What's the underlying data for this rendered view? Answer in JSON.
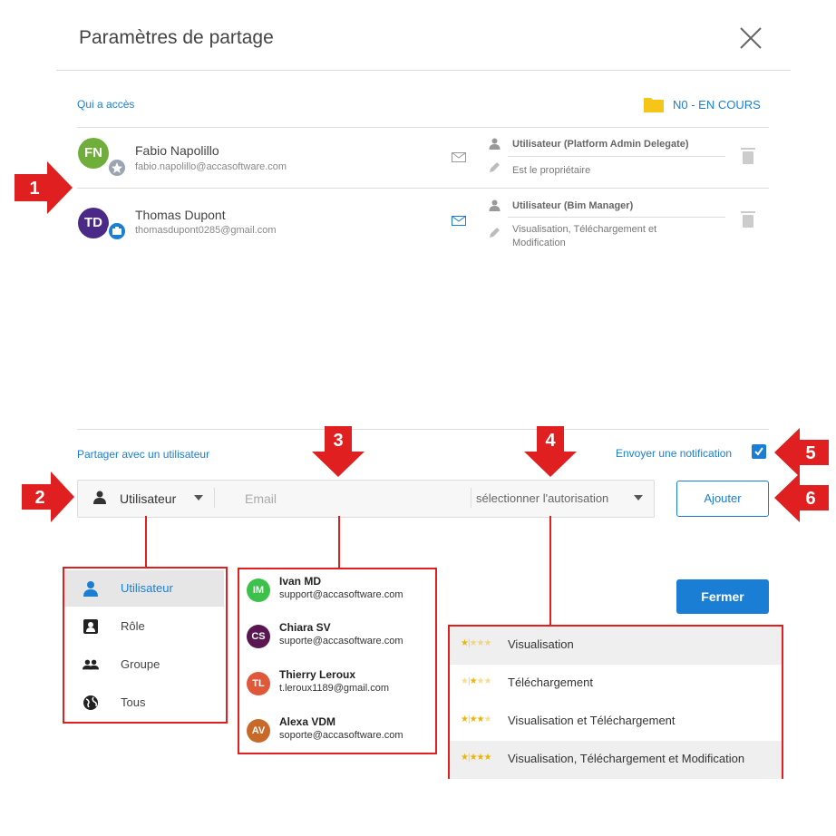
{
  "dialog": {
    "title": "Paramètres de partage",
    "access_label": "Qui a accès",
    "folder_label": "N0 - EN COURS"
  },
  "users": [
    {
      "initials": "FN",
      "name": "Fabio Napolillo",
      "email": "fabio.napolillo@accasoftware.com",
      "role": "Utilisateur (Platform Admin Delegate)",
      "permission": "Est le propriétaire",
      "avatar_color": "#6fae3a",
      "badge_color": "#9aa5b1"
    },
    {
      "initials": "TD",
      "name": "Thomas Dupont",
      "email": "thomasdupont0285@gmail.com",
      "role": "Utilisateur (Bim Manager)",
      "permission": "Visualisation, Téléchargement et Modification",
      "avatar_color": "#4a2a86",
      "badge_color": "#1a7fd4"
    }
  ],
  "share": {
    "label": "Partager avec un utilisateur",
    "notify_label": "Envoyer une notification",
    "notify_checked": true,
    "type_selected": "Utilisateur",
    "email_placeholder": "Email",
    "permission_placeholder": "sélectionner l'autorisation",
    "add_button": "Ajouter",
    "close_button": "Fermer"
  },
  "type_menu": [
    {
      "label": "Utilisateur",
      "icon": "person-icon"
    },
    {
      "label": "Rôle",
      "icon": "badge-icon"
    },
    {
      "label": "Groupe",
      "icon": "group-icon"
    },
    {
      "label": "Tous",
      "icon": "globe-icon"
    }
  ],
  "contacts": [
    {
      "initials": "IM",
      "name": "Ivan MD",
      "email": "support@accasoftware.com",
      "color": "#3cc24a"
    },
    {
      "initials": "CS",
      "name": "Chiara SV",
      "email": "suporte@accasoftware.com",
      "color": "#5a1650"
    },
    {
      "initials": "TL",
      "name": "Thierry Leroux",
      "email": "t.leroux1189@gmail.com",
      "color": "#e0583a"
    },
    {
      "initials": "AV",
      "name": "Alexa VDM",
      "email": "soporte@accasoftware.com",
      "color": "#c8692a"
    }
  ],
  "permissions": [
    {
      "label": "Visualisation",
      "stars": 1
    },
    {
      "label": "Téléchargement",
      "stars": 2
    },
    {
      "label": "Visualisation et Téléchargement",
      "stars": 3
    },
    {
      "label": "Visualisation, Téléchargement et Modification",
      "stars": 4
    }
  ],
  "callouts": [
    "1",
    "2",
    "3",
    "4",
    "5",
    "6"
  ],
  "colors": {
    "accent": "#1a7fd4",
    "callout": "#e02020"
  }
}
